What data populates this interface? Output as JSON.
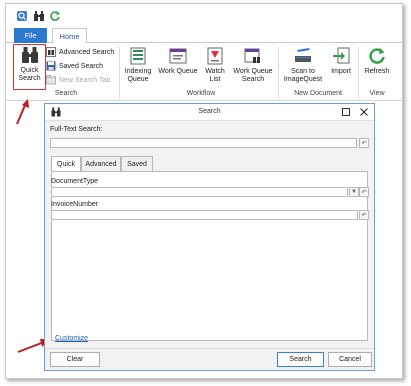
{
  "qat": {
    "icons": [
      "app-search-icon",
      "binoculars-icon",
      "refresh-icon"
    ]
  },
  "ribbon_tabs": {
    "file": "File",
    "home": "Home"
  },
  "ribbon": {
    "search_group": {
      "label": "Search",
      "quick_search_line1": "Quick",
      "quick_search_line2": "Search",
      "advanced_search": "Advanced Search",
      "saved_search": "Saved Search",
      "new_search_tab": "New Search Tab"
    },
    "workflow_group": {
      "label": "Workflow",
      "indexing_queue_line1": "Indexing",
      "indexing_queue_line2": "Queue",
      "work_queue": "Work Queue",
      "watch_list_line1": "Watch",
      "watch_list_line2": "List",
      "work_queue_search_line1": "Work Queue",
      "work_queue_search_line2": "Search"
    },
    "new_document_group": {
      "label": "New Document",
      "scan_line1": "Scan to",
      "scan_line2": "ImageQuest",
      "import": "Import"
    },
    "view_group": {
      "label": "View",
      "refresh": "Refresh"
    }
  },
  "dialog": {
    "title": "Search",
    "full_text_label": "Full-Text Search:",
    "full_text_value": "",
    "tabs": [
      "Quick",
      "Advanced",
      "Saved"
    ],
    "fields": [
      {
        "label": "DocumentType",
        "value": ""
      },
      {
        "label": "InvoiceNumber",
        "value": ""
      }
    ],
    "customize": "Customize",
    "clear": "Clear",
    "search": "Search",
    "cancel": "Cancel"
  },
  "colors": {
    "accent": "#2b79d0",
    "highlight": "#d9343a",
    "link": "#1a5fb4"
  }
}
